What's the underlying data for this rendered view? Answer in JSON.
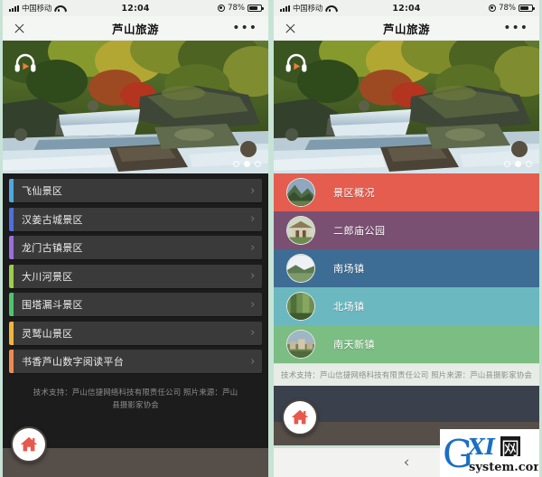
{
  "status_bar": {
    "carrier": "中国移动",
    "time": "12:04",
    "battery_percent": "78%",
    "signal_icon": "signal-bars-icon",
    "wifi_icon": "wifi-icon",
    "location_icon": "location-services-icon",
    "battery_icon": "battery-icon"
  },
  "nav_bar": {
    "title": "芦山旅游",
    "close_icon": "close-x-icon",
    "more_label": "•••"
  },
  "hero": {
    "audio_icon": "headphones-play-icon",
    "dots": [
      {
        "active": false
      },
      {
        "active": true
      },
      {
        "active": false
      }
    ]
  },
  "left_panel": {
    "items": [
      {
        "label": "飞仙景区",
        "color": "#4fa8dc",
        "chevron": "›"
      },
      {
        "label": "汉姜古城景区",
        "color": "#4f6fdc",
        "chevron": "›"
      },
      {
        "label": "龙门古镇景区",
        "color": "#9b6fe0",
        "chevron": "›"
      },
      {
        "label": "大川河景区",
        "color": "#9ccf4a",
        "chevron": "›"
      },
      {
        "label": "围塔漏斗景区",
        "color": "#4ec46e",
        "chevron": "›"
      },
      {
        "label": "灵鹫山景区",
        "color": "#f0b63c",
        "chevron": "›"
      },
      {
        "label": "书香芦山数字阅读平台",
        "color": "#ef8a52",
        "chevron": "›"
      }
    ],
    "footer": "技术支持：芦山信捷网络科技有限责任公司 照片来源：芦山县摄影家协会",
    "home_icon": "home-icon"
  },
  "right_panel": {
    "items": [
      {
        "label": "景区概况",
        "color": "#e45d4f",
        "thumb": "mountain-thumbnail"
      },
      {
        "label": "二郎庙公园",
        "color": "#7a5072",
        "thumb": "temple-thumbnail"
      },
      {
        "label": "南场镇",
        "color": "#3d6d94",
        "thumb": "lake-thumbnail"
      },
      {
        "label": "北场镇",
        "color": "#6bb8c0",
        "thumb": "field-thumbnail"
      },
      {
        "label": "南天新镇",
        "color": "#7bbd82",
        "thumb": "town-thumbnail"
      }
    ],
    "footer": "技术支持：芦山信捷网络科技有限责任公司 照片来源：芦山县摄影家协会",
    "home_icon": "home-icon"
  },
  "browser_bar": {
    "back_label": "‹",
    "forward_label": "›"
  },
  "watermark": {
    "main": "GXI",
    "cjk": "网",
    "sub": "system.com"
  },
  "colors": {
    "page_background": "#c7e3d6",
    "status_bar_bg": "#eef1ee",
    "nav_bar_bg": "#f4f6f4",
    "left_list_bg": "#1c1c1c",
    "brown_bar": "#564e48",
    "home_accent": "#e8584c"
  }
}
